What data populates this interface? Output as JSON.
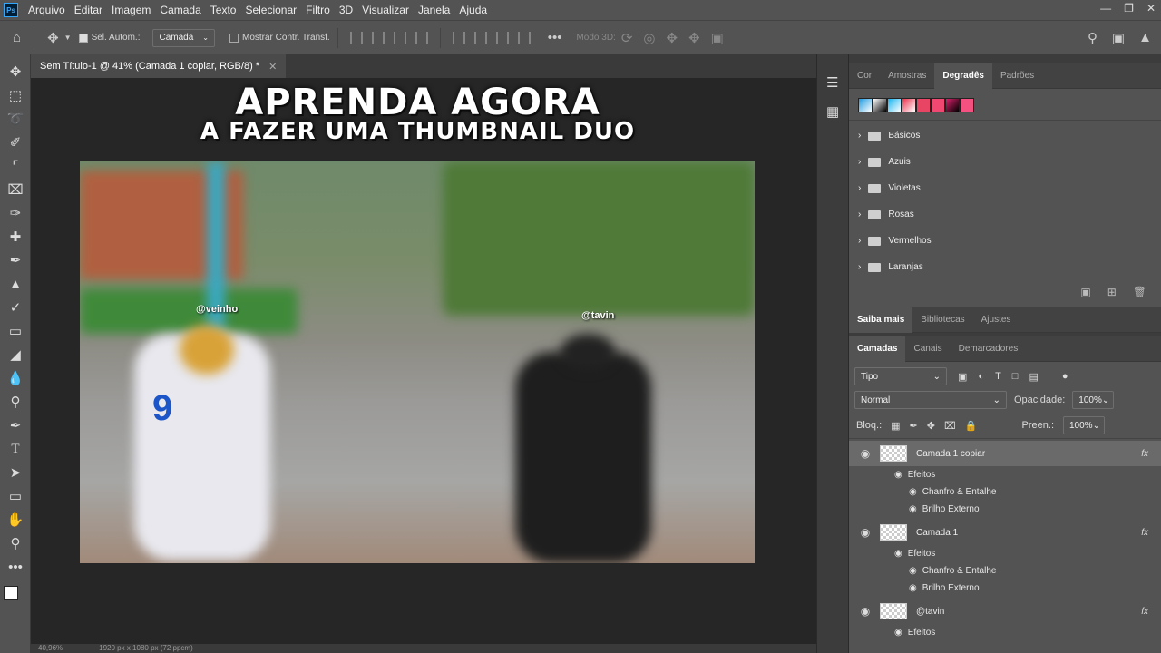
{
  "menubar": {
    "app_logo": "Ps",
    "items": [
      "Arquivo",
      "Editar",
      "Imagem",
      "Camada",
      "Texto",
      "Selecionar",
      "Filtro",
      "3D",
      "Visualizar",
      "Janela",
      "Ajuda"
    ]
  },
  "options": {
    "auto_select_label": "Sel. Autom.:",
    "auto_select_value": "Camada",
    "show_transform_label": "Mostrar Contr. Transf.",
    "mode_3d_label": "Modo 3D:"
  },
  "document": {
    "tab_title": "Sem Título-1 @ 41% (Camada 1 copiar, RGB/8) *",
    "zoom": "40,96%",
    "dimensions": "1920 px x 1080 px (72 ppcm)"
  },
  "thumbnail": {
    "headline_1": "APRENDA AGORA",
    "headline_2": "A FAZER UMA THUMBNAIL DUO",
    "tag_left": "@veinho",
    "tag_right": "@tavin",
    "jersey_number": "9"
  },
  "gradients_panel": {
    "tabs": [
      "Cor",
      "Amostras",
      "Degradês",
      "Padrões"
    ],
    "active_tab": "Degradês",
    "folders": [
      "Básicos",
      "Azuis",
      "Violetas",
      "Rosas",
      "Vermelhos",
      "Laranjas"
    ],
    "swatch_colors": [
      "#1e9be0",
      "#ffffff",
      "#18b4f0",
      "#e8344e",
      "#e84464",
      "#f04870",
      "#d8206a",
      "#f45080"
    ]
  },
  "learn_panel": {
    "tabs": [
      "Saiba mais",
      "Bibliotecas",
      "Ajustes"
    ]
  },
  "layers_panel": {
    "tabs": [
      "Camadas",
      "Canais",
      "Demarcadores"
    ],
    "filter_value": "Tipo",
    "blend_mode": "Normal",
    "opacity_label": "Opacidade:",
    "opacity_value": "100%",
    "lock_label": "Bloq.:",
    "fill_label": "Preen.:",
    "fill_value": "100%",
    "fx_label": "fx",
    "effects_label": "Efeitos",
    "effect_1": "Chanfro & Entalhe",
    "effect_2": "Brilho Externo",
    "layers": [
      "Camada 1 copiar",
      "Camada 1",
      "@tavin"
    ]
  }
}
